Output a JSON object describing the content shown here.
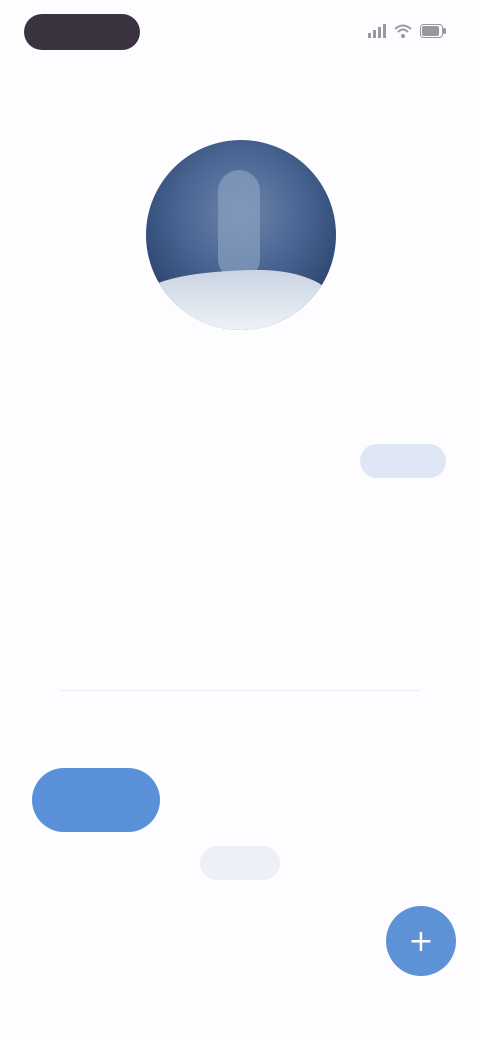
{
  "status_bar": {
    "time": "",
    "icons": [
      "signal-icon",
      "wifi-icon",
      "battery-icon"
    ]
  },
  "nav": {
    "back_label": ""
  },
  "profile": {
    "title": "",
    "subtitle": "",
    "follow_label": "",
    "bio": "",
    "bio_secondary": ""
  },
  "actions": {
    "row1_text": "",
    "primary_label": "",
    "row2_text": "",
    "small_label": "",
    "fab_icon": "plus-icon"
  },
  "colors": {
    "accent": "#5a90d8",
    "background": "#fdfcff"
  }
}
